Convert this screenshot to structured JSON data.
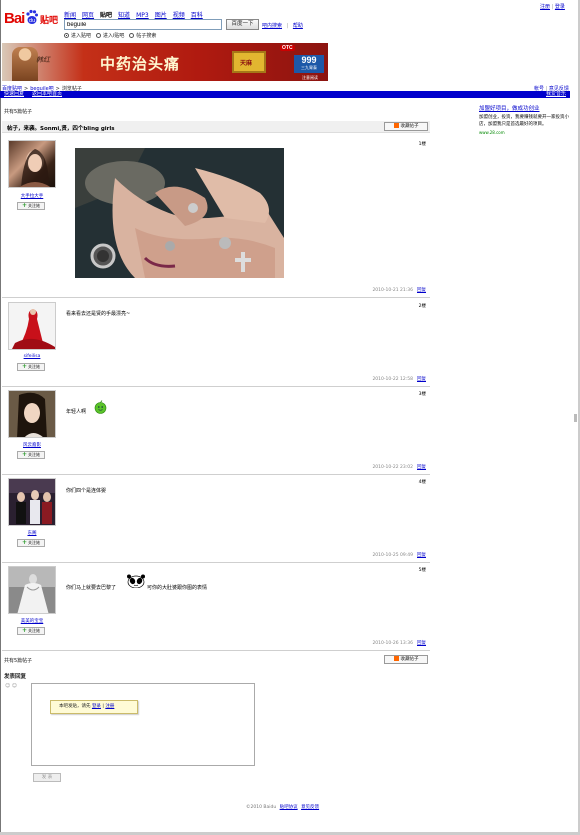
{
  "logo": {
    "bai": "Bai",
    "tieba": "贴吧"
  },
  "top_nav": [
    {
      "label": "新闻",
      "active": false
    },
    {
      "label": "网页",
      "active": false
    },
    {
      "label": "贴吧",
      "active": true
    },
    {
      "label": "知道",
      "active": false
    },
    {
      "label": "MP3",
      "active": false
    },
    {
      "label": "图片",
      "active": false
    },
    {
      "label": "视频",
      "active": false
    },
    {
      "label": "百科",
      "active": false
    }
  ],
  "search": {
    "value": "beguile",
    "button_label": "百度一下",
    "links": [
      "吧内搜索",
      "帮助"
    ],
    "radios": [
      {
        "label": "进入贴吧",
        "checked": true
      },
      {
        "label": "进入i贴吧",
        "checked": false
      },
      {
        "label": "帖子搜索",
        "checked": false
      }
    ]
  },
  "top_right_links": [
    "注册",
    "登录"
  ],
  "banner": {
    "script_text": "韩红",
    "title": "中药治头痛",
    "pack_label": "天麻",
    "otc": "OTC",
    "box_number": "999",
    "box_sub": "三九胃泰",
    "note": "注意阅读"
  },
  "breadcrumb": [
    "百度贴吧",
    "beguile吧",
    "浏览帖子"
  ],
  "top_right_links2": [
    "帐号",
    "意见反馈"
  ],
  "bluebar": {
    "left": [
      "快速回复",
      "返回本吧首页"
    ],
    "right": "我爱音乐"
  },
  "totals": {
    "top": "共有5篇帖子",
    "bottom": "共有5篇帖子"
  },
  "thread": {
    "title": "帖子，来袭。Sonmi,贤，四个bling girls",
    "fav_label": "收藏帖子"
  },
  "side_ad": {
    "title": "加盟好项目，做成功创业",
    "desc": "加盟创业，投资，我要赚钱就要开一家投资小店，加盟我只是首选最好的项目。",
    "url": "www.28.com"
  },
  "posts": [
    {
      "username": "大手拉大手",
      "floor": "1楼",
      "content": "",
      "time": "2010-10-21 21:36",
      "reply": "回复",
      "follow": "关注她"
    },
    {
      "username": "sifeilisa",
      "floor": "2楼",
      "content": "看来看去还是贤的手最漂亮~",
      "time": "2010-10-22 12:58",
      "reply": "回复",
      "follow": "关注她"
    },
    {
      "username": "风云裔影",
      "floor": "3楼",
      "content": "年轻人啊",
      "time": "2010-10-22 23:02",
      "reply": "回复",
      "follow": "关注她"
    },
    {
      "username": "东阁",
      "floor": "4楼",
      "content": "你们四个是连体婴",
      "time": "2010-10-25 09:49",
      "reply": "回复",
      "follow": "关注她"
    },
    {
      "username": "美美的宝宝",
      "floor": "5楼",
      "content_a": "你们马上就要去巴黎了",
      "content_b": "可你的大肚婆跟你图的表情",
      "time": "2010-10-26 13:36",
      "reply": "回复",
      "follow": "关注她"
    }
  ],
  "reply": {
    "heading": "发表回复",
    "smiles": "☺ ☺",
    "tip_text": "本吧发贴，请先",
    "tip_login": "登录",
    "tip_sep": "|",
    "tip_register": "注册",
    "submit": "发 表"
  },
  "footer": {
    "copy": "©2010 Baidu",
    "links": [
      "贴吧协议",
      "意见反馈"
    ]
  }
}
